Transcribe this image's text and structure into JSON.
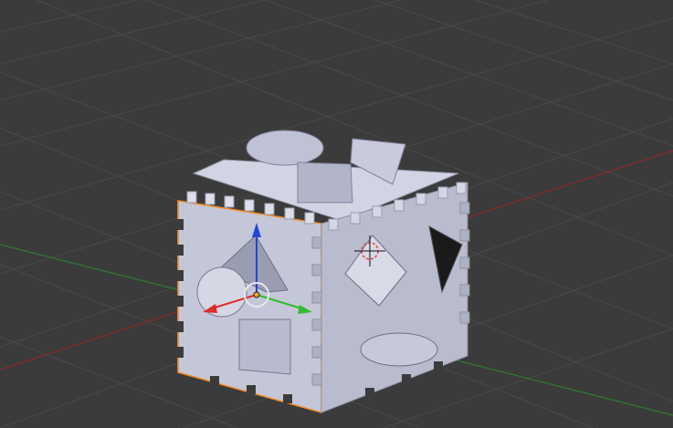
{
  "app": {
    "name": "3D viewport",
    "view": "perspective"
  },
  "viewport": {
    "background_color": "#3b3b3b",
    "grid_color": "#4a4a4a",
    "x_axis_color": "#8a2a2a",
    "y_axis_color": "#2f7a2f"
  },
  "scene_object": {
    "type": "shape-sorter-cube",
    "selected": true,
    "selection_outline_color": "#f08b2a",
    "face_color": "#c4c7d7",
    "side_face_color": "#b7bacb",
    "top_face_color": "#d2d4e3"
  },
  "gizmo": {
    "x_color": "#e12a2a",
    "y_color": "#2fbe2f",
    "z_color": "#2346d6",
    "center_color": "#e8e8e8"
  },
  "cursor_3d": {
    "ring_color": "#e2473b",
    "cross_color": "#111111"
  }
}
